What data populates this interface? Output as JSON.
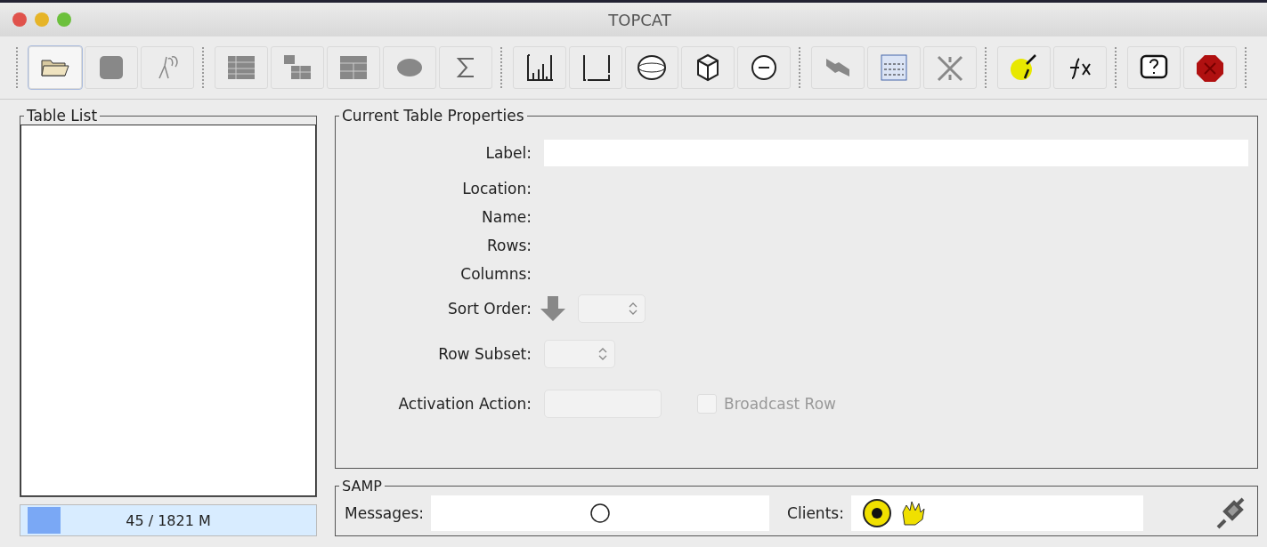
{
  "window": {
    "title": "TOPCAT"
  },
  "table_list": {
    "title": "Table List"
  },
  "memory": {
    "reading": "45 / 1821 M",
    "level": 0.11
  },
  "properties": {
    "title": "Current Table Properties",
    "label": {
      "label": "Label:"
    },
    "info": [
      {
        "label": "Location:"
      },
      {
        "label": "Name:"
      },
      {
        "label": "Rows:"
      },
      {
        "label": "Columns:"
      }
    ],
    "sort_order": {
      "label": "Sort Order:",
      "disabled": true
    },
    "row_subset": {
      "label": "Row Subset:",
      "disabled": true
    },
    "activation": {
      "label": "Activation Action:",
      "disabled": true
    },
    "broadcast": {
      "label": "Broadcast Row",
      "checked": false,
      "disabled": true
    }
  },
  "samp": {
    "title": "SAMP",
    "messages_label": "Messages:",
    "clients_label": "Clients:"
  }
}
